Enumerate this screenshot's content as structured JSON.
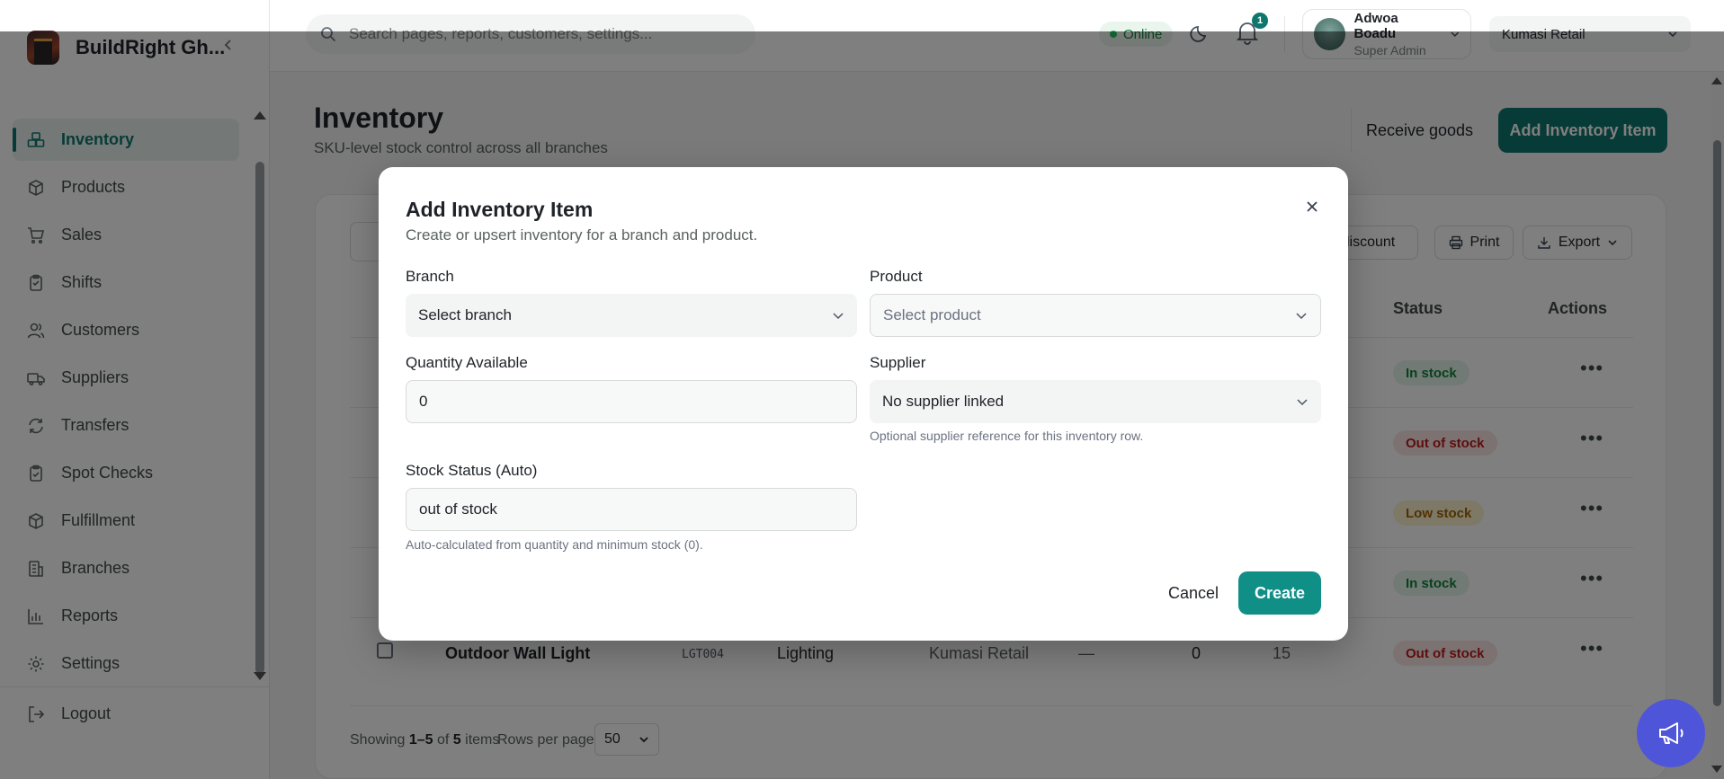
{
  "brand": {
    "name": "BuildRight Gh..."
  },
  "sidebar": {
    "items": [
      {
        "label": "Inventory",
        "icon": "boxes-icon",
        "active": true
      },
      {
        "label": "Products",
        "icon": "package-icon"
      },
      {
        "label": "Sales",
        "icon": "cart-icon"
      },
      {
        "label": "Shifts",
        "icon": "clipboard-icon"
      },
      {
        "label": "Customers",
        "icon": "users-icon"
      },
      {
        "label": "Suppliers",
        "icon": "truck-icon"
      },
      {
        "label": "Transfers",
        "icon": "refresh-icon"
      },
      {
        "label": "Spot Checks",
        "icon": "clipboard-check-icon"
      },
      {
        "label": "Fulfillment",
        "icon": "package-check-icon"
      },
      {
        "label": "Branches",
        "icon": "building-icon"
      },
      {
        "label": "Reports",
        "icon": "bar-chart-icon"
      },
      {
        "label": "Settings",
        "icon": "gear-icon"
      }
    ],
    "logout_label": "Logout"
  },
  "topbar": {
    "search_placeholder": "Search pages, reports, customers, settings...",
    "status": "Online",
    "notifications_count": "1",
    "user": {
      "name": "Adwoa Boadu",
      "role": "Super Admin"
    },
    "branch": "Kumasi Retail"
  },
  "page": {
    "title": "Inventory",
    "subtitle": "SKU-level stock control across all branches",
    "receive_label": "Receive goods",
    "add_label": "Add Inventory Item"
  },
  "toolbar": {
    "discount_label": "t discount",
    "print_label": "Print",
    "export_label": "Export"
  },
  "table": {
    "headers": {
      "status": "Status",
      "actions": "Actions"
    },
    "statuses": [
      "In stock",
      "Out of stock",
      "Low stock",
      "In stock",
      "Out of stock"
    ],
    "last_row": {
      "name": "Outdoor Wall Light",
      "sku": "LGT004",
      "category": "Lighting",
      "branch": "Kumasi Retail",
      "supplier": "—",
      "quantity": "0",
      "min_stock": "15"
    },
    "footer": {
      "prefix": "Showing",
      "range": "1–5",
      "of": "of",
      "total": "5",
      "suffix": "items"
    },
    "rows_per_page_label": "Rows per page",
    "rows_per_page_value": "50"
  },
  "modal": {
    "title": "Add Inventory Item",
    "subtitle": "Create or upsert inventory for a branch and product.",
    "branch_label": "Branch",
    "branch_placeholder": "Select branch",
    "product_label": "Product",
    "product_placeholder": "Select product",
    "quantity_label": "Quantity Available",
    "quantity_value": "0",
    "supplier_label": "Supplier",
    "supplier_value": "No supplier linked",
    "supplier_hint": "Optional supplier reference for this inventory row.",
    "stock_status_label": "Stock Status (Auto)",
    "stock_status_value": "out of stock",
    "stock_status_hint": "Auto-calculated from quantity and minimum stock (0).",
    "cancel_label": "Cancel",
    "create_label": "Create"
  },
  "colors": {
    "accent": "#0f766e",
    "create_button": "#0f8f86",
    "announce_button": "#4f55d9"
  }
}
